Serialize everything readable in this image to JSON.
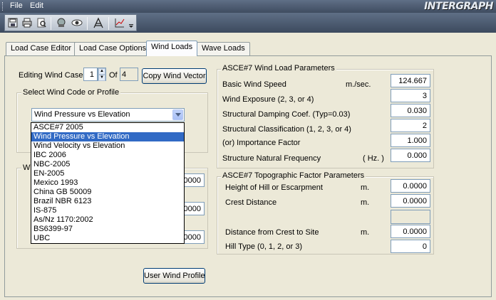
{
  "menu": {
    "file": "File",
    "edit": "Edit"
  },
  "logo": "INTERGRAPH",
  "tabs": [
    {
      "label": "Load Case Editor"
    },
    {
      "label": "Load Case Options"
    },
    {
      "label": "Wind Loads",
      "active": true
    },
    {
      "label": "Wave Loads"
    }
  ],
  "editing": {
    "label": "Editing Wind Case",
    "current": "1",
    "of_label": "Of",
    "total": "4",
    "copy_button": "Copy Wind Vector"
  },
  "wind_code": {
    "group_title": "Select Wind Code or Profile",
    "selected": "Wind Pressure vs Elevation",
    "options": [
      "ASCE#7 2005",
      "Wind Pressure vs Elevation",
      "Wind Velocity vs Elevation",
      "IBC 2006",
      "NBC-2005",
      "EN-2005",
      "Mexico 1993",
      "China GB 50009",
      "Brazil NBR 6123",
      "IS-875",
      "As/Nz 1170:2002",
      "BS6399-97",
      "UBC"
    ]
  },
  "hidden_group": {
    "title_fragment": "W",
    "values": [
      "0000",
      "0000",
      "0000"
    ]
  },
  "user_profile_button": "User Wind Profile",
  "asce_params": {
    "title": "ASCE#7 Wind Load Parameters",
    "rows": [
      {
        "label": "Basic Wind Speed",
        "unit": "m./sec.",
        "value": "124.667"
      },
      {
        "label": "Wind Exposure  (2, 3, or 4)",
        "unit": "",
        "value": "3"
      },
      {
        "label": "Structural Damping Coef.  (Typ=0.03)",
        "unit": "",
        "value": "0.030"
      },
      {
        "label": "Structural Classification  (1, 2, 3, or 4)",
        "unit": "",
        "value": "2"
      },
      {
        "label": "(or) Importance Factor",
        "unit": "",
        "value": "1.000"
      },
      {
        "label": "Structure Natural Frequency",
        "unit": "( Hz. )",
        "value": "0.000"
      }
    ]
  },
  "topo_params": {
    "title": "ASCE#7 Topographic Factor Parameters",
    "rows": [
      {
        "label": "Height of Hill or Escarpment",
        "unit": "m.",
        "value": "0.0000"
      },
      {
        "label": "Crest Distance",
        "unit": "m.",
        "value": "0.0000"
      },
      {
        "label": "",
        "unit": "",
        "value": ""
      },
      {
        "label": "Distance from Crest to Site",
        "unit": "m.",
        "value": "0.0000"
      },
      {
        "label": "Hill Type  (0, 1, 2, or 3)",
        "unit": "",
        "value": "0"
      }
    ]
  },
  "colors": {
    "selection": "#316ac5",
    "chrome": "#ece9d8",
    "toolbar": "#4d5b70"
  }
}
